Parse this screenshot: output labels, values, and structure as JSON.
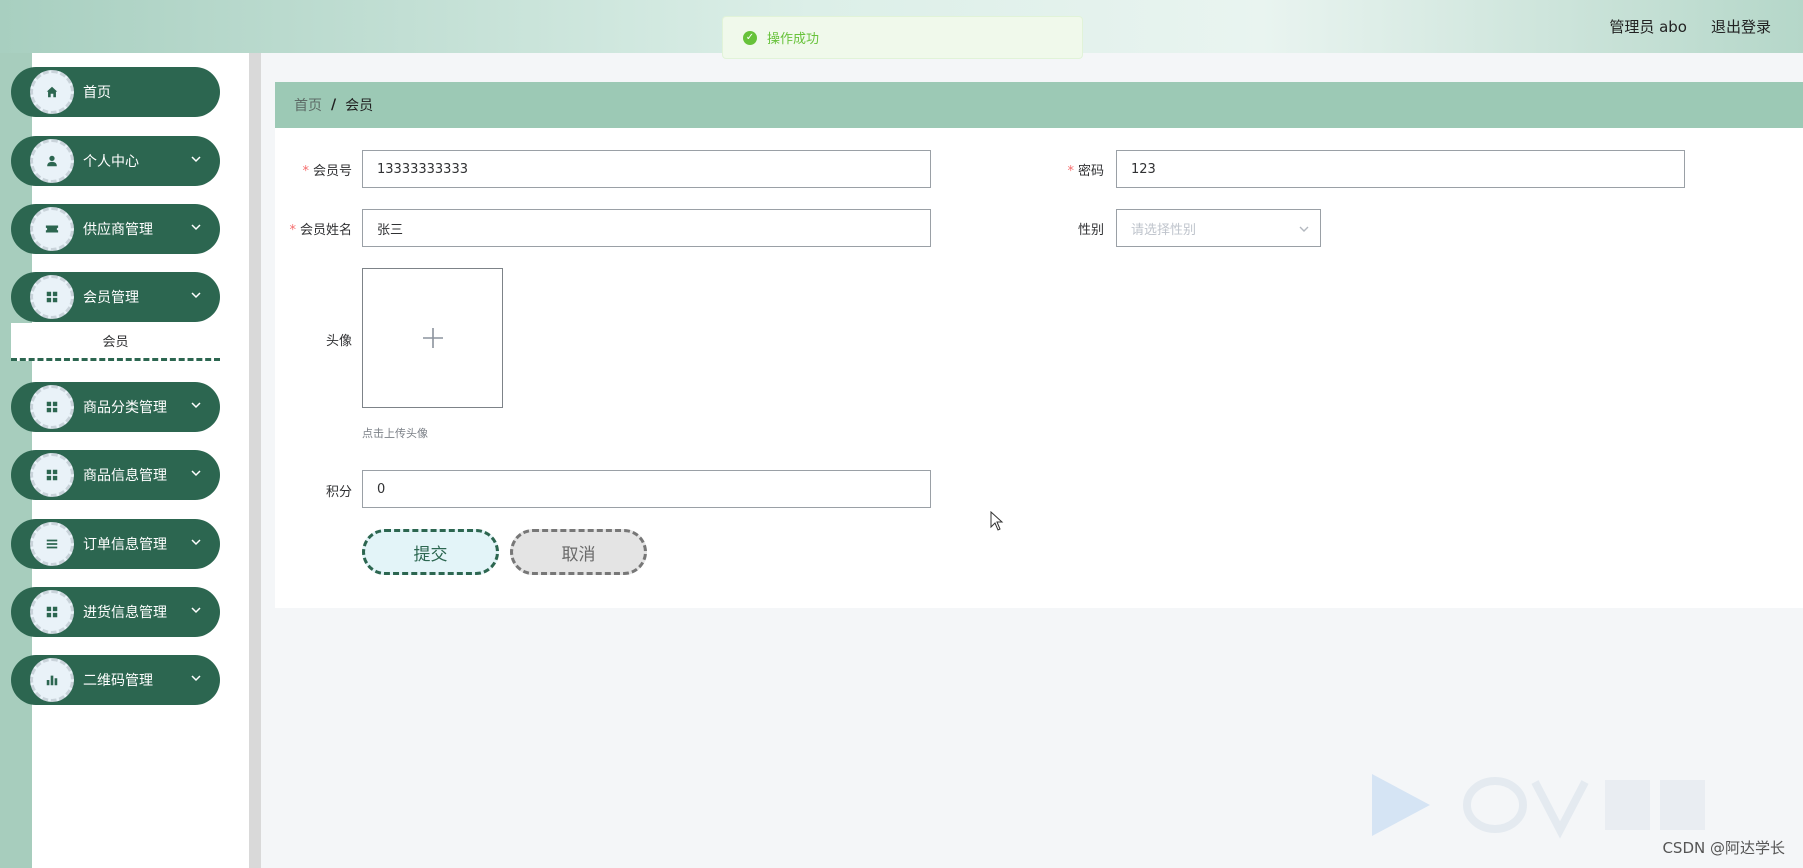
{
  "header": {
    "title": "",
    "user_label": "管理员 abo",
    "logout_label": "退出登录"
  },
  "toast": {
    "message": "操作成功"
  },
  "sidebar": {
    "items": [
      {
        "label": "首页",
        "icon": "home-icon"
      },
      {
        "label": "个人中心",
        "icon": "user-icon"
      },
      {
        "label": "供应商管理",
        "icon": "ticket-icon"
      },
      {
        "label": "会员管理",
        "icon": "grid-icon"
      },
      {
        "label": "商品分类管理",
        "icon": "grid-icon"
      },
      {
        "label": "商品信息管理",
        "icon": "grid-icon"
      },
      {
        "label": "订单信息管理",
        "icon": "list-icon"
      },
      {
        "label": "进货信息管理",
        "icon": "grid-icon"
      },
      {
        "label": "二维码管理",
        "icon": "bar-chart-icon"
      }
    ],
    "active_sub": "会员"
  },
  "breadcrumb": {
    "home": "首页",
    "separator": "/",
    "current": "会员"
  },
  "form": {
    "member_no": {
      "label": "会员号",
      "value": "13333333333"
    },
    "password": {
      "label": "密码",
      "value": "123"
    },
    "member_name": {
      "label": "会员姓名",
      "value": "张三"
    },
    "gender": {
      "label": "性别",
      "placeholder": "请选择性别"
    },
    "avatar": {
      "label": "头像",
      "tip": "点击上传头像"
    },
    "points": {
      "label": "积分",
      "value": "0"
    },
    "submit_label": "提交",
    "cancel_label": "取消"
  },
  "footer": {
    "credit": "CSDN @阿达学长"
  },
  "colors": {
    "sidebar_item": "#2c6650",
    "breadcrumb_bar": "#9cc9b5",
    "success": "#67c23a",
    "required": "#f56c6c"
  }
}
